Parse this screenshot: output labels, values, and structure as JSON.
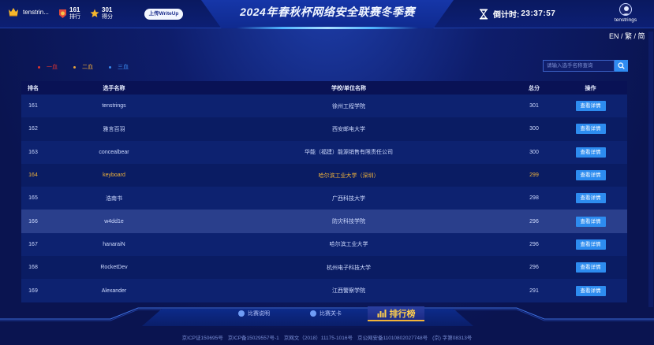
{
  "header": {
    "title": "2024年春秋杯网络安全联赛冬季赛",
    "username": "tenstrin...",
    "rank_value": "161",
    "rank_label": "排行",
    "score_value": "301",
    "score_label": "得分",
    "writeup_label": "上传WriteUp",
    "countdown_label": "倒计时:",
    "countdown_value": "23:37:57",
    "avatar_name": "tenstrings",
    "language_switch": "EN / 繁 / 简"
  },
  "legend": [
    {
      "label": "一血",
      "color": "#e0342f"
    },
    {
      "label": "二血",
      "color": "#e6a33a"
    },
    {
      "label": "三血",
      "color": "#3b8bf0"
    }
  ],
  "search": {
    "placeholder": "请输入选手名称查询"
  },
  "table": {
    "headers": {
      "rank": "排名",
      "name": "选手名称",
      "school": "学校/单位名称",
      "score": "总分",
      "op": "操作"
    },
    "detail_label": "查看详情",
    "rows": [
      {
        "rank": "161",
        "name": "tenstrings",
        "school": "徐州工程学院",
        "score": "301"
      },
      {
        "rank": "162",
        "name": "雅言百羽",
        "school": "西安邮电大学",
        "score": "300"
      },
      {
        "rank": "163",
        "name": "concealbear",
        "school": "华能（福建）能源销售有限责任公司",
        "score": "300"
      },
      {
        "rank": "164",
        "name": "keyboard",
        "school": "哈尔滨工业大学（深圳）",
        "score": "299"
      },
      {
        "rank": "165",
        "name": "浩南书",
        "school": "广西科技大学",
        "score": "298"
      },
      {
        "rank": "166",
        "name": "w4dd1e",
        "school": "防灾科技学院",
        "score": "296"
      },
      {
        "rank": "167",
        "name": "hanaraiN",
        "school": "哈尔滨工业大学",
        "score": "296"
      },
      {
        "rank": "168",
        "name": "RocketDev",
        "school": "杭州电子科技大学",
        "score": "296"
      },
      {
        "rank": "169",
        "name": "Alexander",
        "school": "江西警察学院",
        "score": "291"
      }
    ]
  },
  "bottom_nav": {
    "rules": "比赛说明",
    "levels": "比赛关卡",
    "leaderboard": "排行榜"
  },
  "footer": {
    "icp1": "京ICP证150695号",
    "icp2": "京ICP备15029557号-1",
    "culture": "京网文（2018）11175-1016号",
    "police": "京公网安备11010802027748号",
    "edu": "(京) 字第08313号"
  },
  "colors": {
    "accent": "#2d8cf0",
    "highlight": "#f1b33a",
    "background": "#0b1657"
  }
}
